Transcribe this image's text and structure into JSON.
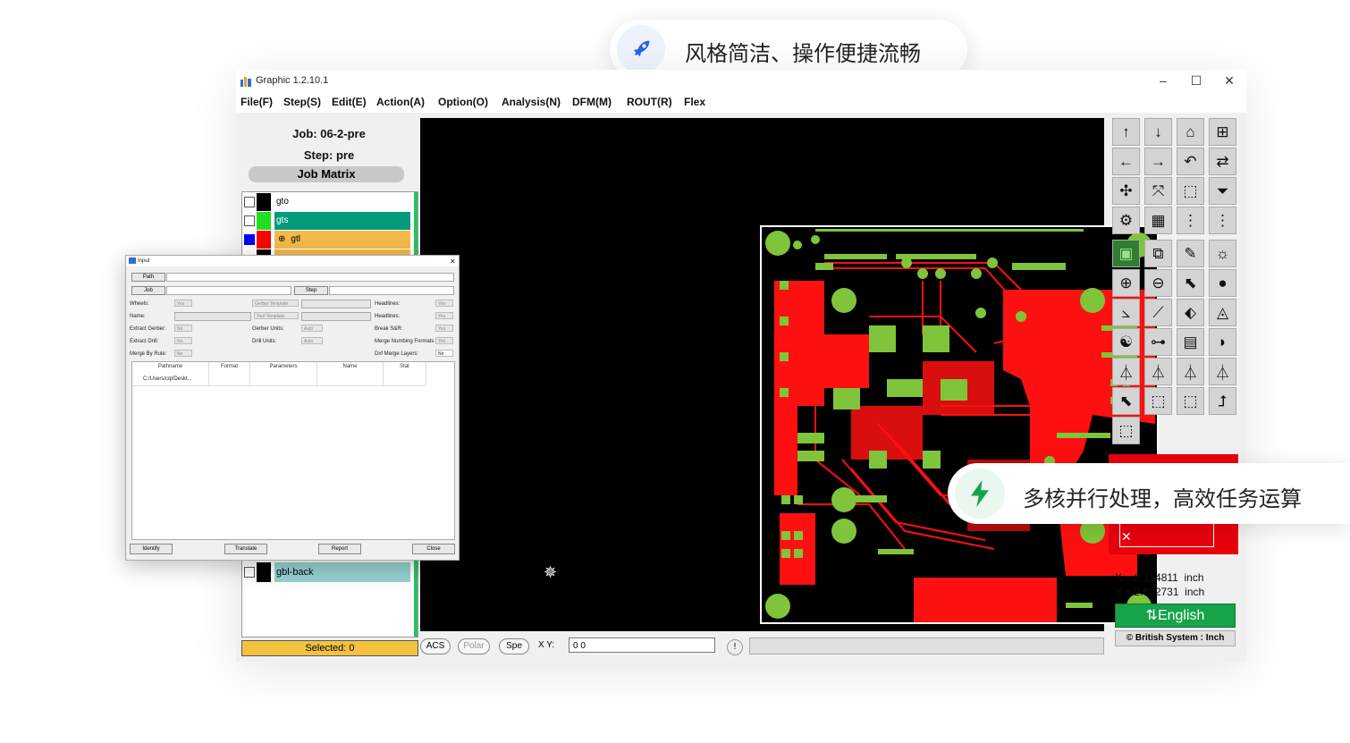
{
  "chips": {
    "top": {
      "text": "风格简洁、操作便捷流畅",
      "icon": "rocket-icon",
      "accent": "#2563eb"
    },
    "right": {
      "text": "多核并行处理，高效任务运算",
      "icon": "lightning-icon",
      "accent": "#16a34a"
    }
  },
  "window": {
    "title": "Graphic 1.2.10.1",
    "controls": [
      "–",
      "☐",
      "✕"
    ]
  },
  "menu": [
    "File(F)",
    "Step(S)",
    "Edit(E)",
    "Action(A)",
    "Option(O)",
    "Analysis(N)",
    "DFM(M)",
    "ROUT(R)",
    "Flex"
  ],
  "left_panel": {
    "job": "Job: 06-2-pre",
    "step": "Step: pre",
    "matrix_label": "Job Matrix",
    "layers": [
      {
        "name": "gto",
        "color": "#000000",
        "bg": "#ffffff",
        "check": "#ffffff"
      },
      {
        "name": "gts",
        "color": "#22dd22",
        "bg": "#049b7b",
        "check": "#ffffff"
      },
      {
        "name": "gtl",
        "color": "#ff0000",
        "bg": "#f3b94a",
        "check": "#0000ff",
        "symbol": "⊕"
      },
      {
        "name": "gbl-back",
        "color": "#000000",
        "bg": "#96d0d0",
        "check": "#ffffff"
      }
    ],
    "selected": "Selected: 0"
  },
  "bottom_bar": {
    "acs": "ACS",
    "polar": "Polar",
    "spe": "Spe",
    "xy_label": "X Y:",
    "xy_value": "0 0",
    "warn": "!"
  },
  "toolbar_icons": [
    [
      "↑",
      "↓",
      "⌂",
      "⊞"
    ],
    [
      "←",
      "→",
      "↶",
      "⇄"
    ],
    [
      "✣",
      "⤧",
      "⬚",
      "⏷"
    ],
    [
      "⚙",
      "▦",
      "⋮",
      "⋮"
    ],
    [
      "▣",
      "⧉",
      "✎",
      "☼"
    ],
    [
      "⊕",
      "⊖",
      "⬉",
      "●"
    ],
    [
      "⦣",
      "⟋",
      "⬖",
      "◬"
    ],
    [
      "☯",
      "⊶",
      "▤",
      "◗"
    ],
    [
      "⏃",
      "⏃",
      "⏃",
      "⏃"
    ],
    [
      "⬉",
      "⬚",
      "⬚",
      "⮥"
    ],
    [
      "⬚",
      "",
      "",
      ""
    ]
  ],
  "coords": {
    "x": "X = 2.124811  inch",
    "y": "Y = 2.602731  inch"
  },
  "lang_button": "⇅English",
  "unit_button": "British System : Inch",
  "dialog": {
    "title": "Input",
    "path_btn": "Path",
    "job_btn": "Job",
    "step_btn": "Step",
    "labels": {
      "wheels": "Wheels:",
      "gerber_template": "Gerber Template",
      "headlines1": "Headlines:",
      "name": "Name:",
      "tool_template": "Tool Template:",
      "headlines2": "Headlines:",
      "extract_gerber": "Extract Gerber:",
      "gerber_units": "Gerber Units:",
      "break_sr": "Break S&R:",
      "extract_drill": "Extract Drill:",
      "drill_units": "Drill Units:",
      "merge_numbering": "Merge Numbing Formats",
      "merge_by_rule": "Merge By Rule:",
      "dxf_merge": "Dxf Merge Layers:"
    },
    "values": {
      "wheels": "Yes",
      "headlines1": "Yes",
      "headlines2": "Yes",
      "extract_gerber": "No",
      "gerber_units": "Auto",
      "break_sr": "Yes",
      "extract_drill": "No",
      "drill_units": "Auto",
      "merge_numbering": "Yes",
      "merge_by_rule": "No",
      "dxf_merge": "No"
    },
    "columns": [
      "Pathname",
      "Format",
      "Parameters",
      "Name",
      "Stat"
    ],
    "row": "C:/Users/cql/Deskt...",
    "buttons": {
      "identify": "Identify",
      "translate": "Translate",
      "report": "Report",
      "close": "Close"
    }
  },
  "colors": {
    "pcb_copper": "#ff1010",
    "pcb_pad": "#7fc43a",
    "canvas": "#000000"
  }
}
